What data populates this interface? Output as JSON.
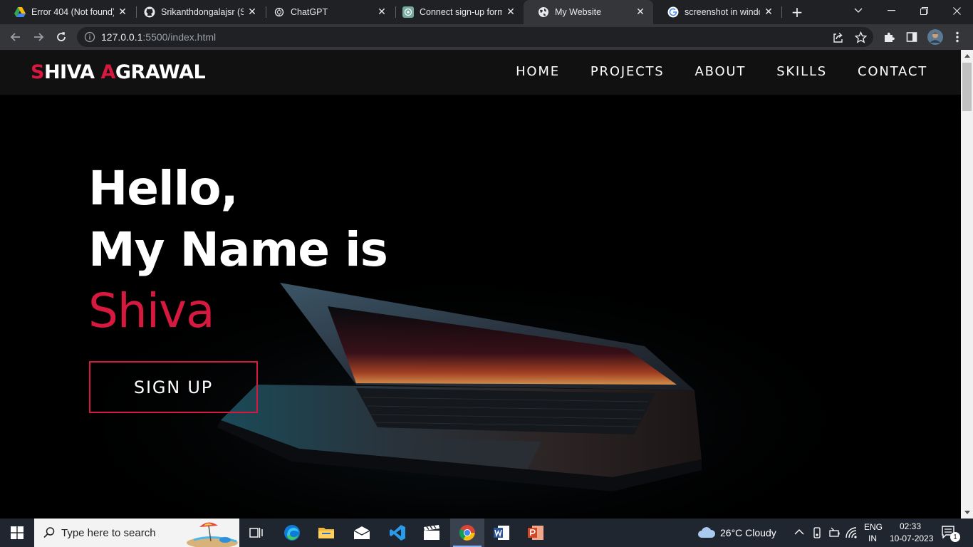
{
  "browser": {
    "tabs": [
      {
        "title": "Error 404 (Not found)!!!",
        "icon": "google-drive-icon"
      },
      {
        "title": "Srikanthdongalajsr (Srikanth)",
        "icon": "github-icon"
      },
      {
        "title": "ChatGPT",
        "icon": "chatgpt-icon"
      },
      {
        "title": "Connect sign-up form",
        "icon": "chatgpt-icon"
      },
      {
        "title": "My Website",
        "icon": "globe-icon"
      },
      {
        "title": "screenshot in windows",
        "icon": "google-icon"
      }
    ],
    "active_tab_index": 4,
    "url_host": "127.0.0.1",
    "url_rest": ":5500/index.html"
  },
  "site": {
    "logo_first_initial": "S",
    "logo_first_rest": "HIVA ",
    "logo_last_initial": "A",
    "logo_last_rest": "GRAWAL",
    "nav": [
      "HOME",
      "PROJECTS",
      "ABOUT",
      "SKILLS",
      "CONTACT"
    ],
    "hero_line1": "Hello,",
    "hero_line2": "My Name is",
    "hero_name": "Shiva",
    "signup_label": "SIGN UP",
    "accent_color": "#d7193f"
  },
  "taskbar": {
    "search_placeholder": "Type here to search",
    "weather": "26°C  Cloudy",
    "lang_top": "ENG",
    "lang_bottom": "IN",
    "time": "02:33",
    "date": "10-07-2023",
    "notification_count": "1"
  }
}
